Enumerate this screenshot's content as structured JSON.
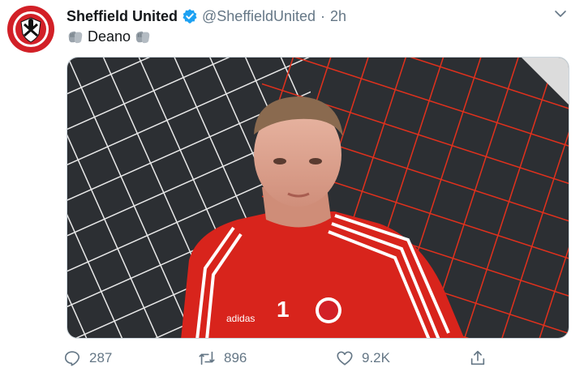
{
  "tweet": {
    "author_name": "Sheffield United",
    "handle": "@SheffieldUnited",
    "separator": "·",
    "time": "2h",
    "text": "Deano",
    "emoji_icon": "gloves-icon"
  },
  "actions": {
    "replies": "287",
    "retweets": "896",
    "likes": "9.2K"
  },
  "colors": {
    "verified": "#1da1f2",
    "club_red": "#d22027",
    "net_red": "#e2301c",
    "muted": "#657786"
  }
}
